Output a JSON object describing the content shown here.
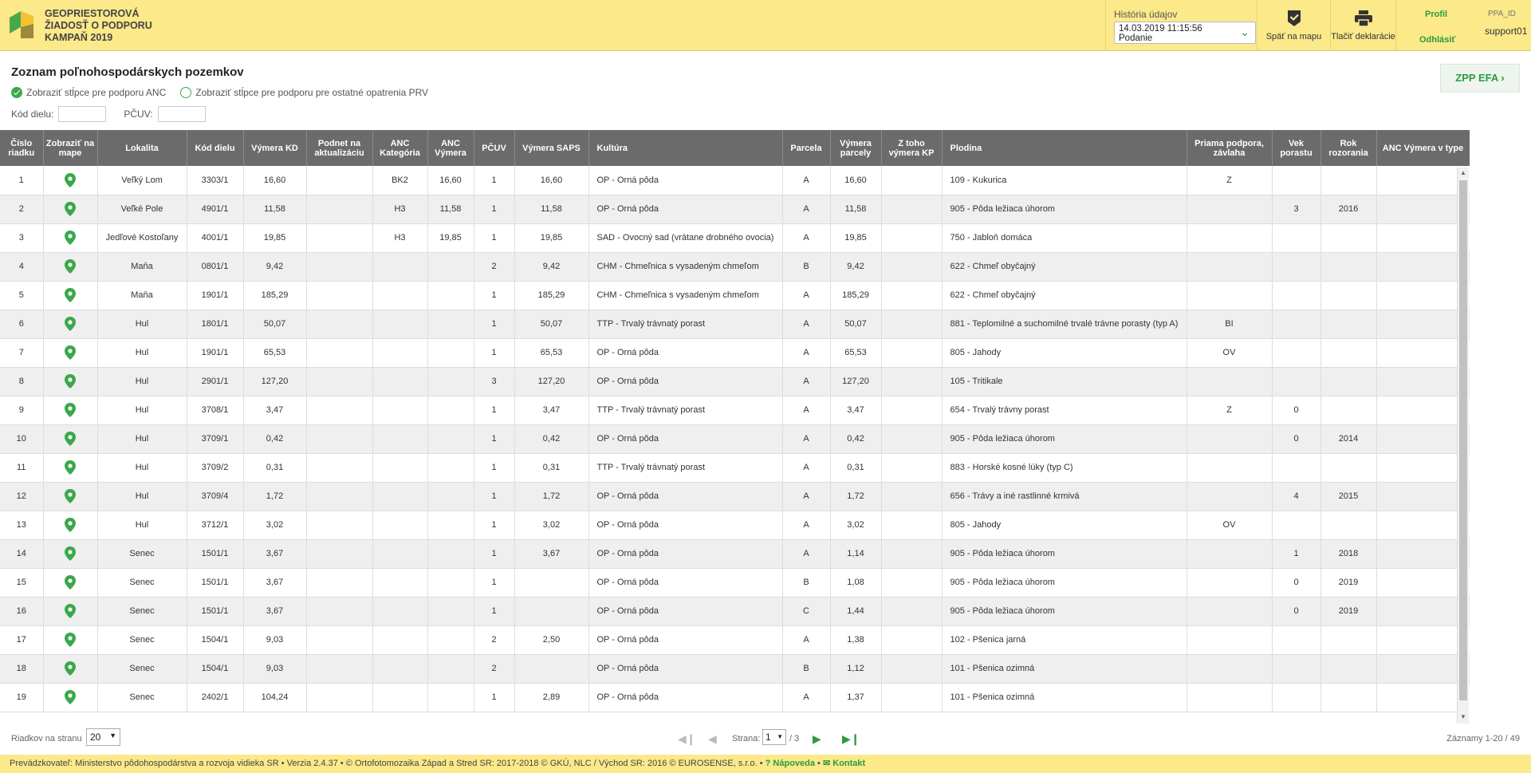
{
  "header": {
    "app_title_lines": [
      "GEOPRIESTOROVÁ",
      "ŽIADOSŤ O PODPORU",
      "KAMPAŇ 2019"
    ],
    "history_label": "História údajov",
    "history_value_line1": "14.03.2019 11:15:56",
    "history_value_line2": "Podanie",
    "back_to_map": "Späť na mapu",
    "print_declaration": "Tlačiť deklarácie",
    "profile": "Profil",
    "logout": "Odhlásiť",
    "user_label": "PPA_ID",
    "user_name": "support01"
  },
  "page": {
    "title": "Zoznam poľnohospodárskych pozemkov",
    "option_anc": "Zobraziť stĺpce pre podporu ANC",
    "option_prv": "Zobraziť stĺpce pre podporu pre ostatné opatrenia PRV",
    "filter_kod_dielu": "Kód dielu:",
    "filter_pcuv": "PČUV:",
    "zpp_efa_button": "ZPP EFA"
  },
  "table": {
    "headers": [
      "Číslo riadku",
      "Zobraziť na mape",
      "Lokalita",
      "Kód dielu",
      "Výmera KD",
      "Podnet na aktualizáciu",
      "ANC Kategória",
      "ANC Výmera",
      "PČUV",
      "Výmera SAPS",
      "Kultúra",
      "Parcela",
      "Výmera parcely",
      "Z toho výmera KP",
      "Plodina",
      "Priama podpora, závlaha",
      "Vek porastu",
      "Rok rozorania",
      "ANC Výmera v type"
    ],
    "rows": [
      [
        "1",
        "",
        "Veľký Lom",
        "3303/1",
        "16,60",
        "",
        "BK2",
        "16,60",
        "1",
        "16,60",
        "OP - Orná pôda",
        "A",
        "16,60",
        "",
        "109 - Kukurica",
        "Z",
        "",
        "",
        ""
      ],
      [
        "2",
        "",
        "Veľké Pole",
        "4901/1",
        "11,58",
        "",
        "H3",
        "11,58",
        "1",
        "11,58",
        "OP - Orná pôda",
        "A",
        "11,58",
        "",
        "905 - Pôda ležiaca úhorom",
        "",
        "3",
        "2016",
        ""
      ],
      [
        "3",
        "",
        "Jedľové Kostoľany",
        "4001/1",
        "19,85",
        "",
        "H3",
        "19,85",
        "1",
        "19,85",
        "SAD - Ovocný sad (vrátane drobného ovocia)",
        "A",
        "19,85",
        "",
        "750 - Jabloň domáca",
        "",
        "",
        "",
        ""
      ],
      [
        "4",
        "",
        "Maňa",
        "0801/1",
        "9,42",
        "",
        "",
        "",
        "2",
        "9,42",
        "CHM - Chmeľnica s vysadeným chmeľom",
        "B",
        "9,42",
        "",
        "622 - Chmeľ obyčajný",
        "",
        "",
        "",
        ""
      ],
      [
        "5",
        "",
        "Maňa",
        "1901/1",
        "185,29",
        "",
        "",
        "",
        "1",
        "185,29",
        "CHM - Chmeľnica s vysadeným chmeľom",
        "A",
        "185,29",
        "",
        "622 - Chmeľ obyčajný",
        "",
        "",
        "",
        ""
      ],
      [
        "6",
        "",
        "Hul",
        "1801/1",
        "50,07",
        "",
        "",
        "",
        "1",
        "50,07",
        "TTP - Trvalý trávnatý porast",
        "A",
        "50,07",
        "",
        "881 - Teplomilné a suchomilné trvalé trávne porasty (typ A)",
        "BI",
        "",
        "",
        ""
      ],
      [
        "7",
        "",
        "Hul",
        "1901/1",
        "65,53",
        "",
        "",
        "",
        "1",
        "65,53",
        "OP - Orná pôda",
        "A",
        "65,53",
        "",
        "805 - Jahody",
        "OV",
        "",
        "",
        ""
      ],
      [
        "8",
        "",
        "Hul",
        "2901/1",
        "127,20",
        "",
        "",
        "",
        "3",
        "127,20",
        "OP - Orná pôda",
        "A",
        "127,20",
        "",
        "105 - Tritikale",
        "",
        "",
        "",
        ""
      ],
      [
        "9",
        "",
        "Hul",
        "3708/1",
        "3,47",
        "",
        "",
        "",
        "1",
        "3,47",
        "TTP - Trvalý trávnatý porast",
        "A",
        "3,47",
        "",
        "654 - Trvalý trávny porast",
        "Z",
        "0",
        "",
        ""
      ],
      [
        "10",
        "",
        "Hul",
        "3709/1",
        "0,42",
        "",
        "",
        "",
        "1",
        "0,42",
        "OP - Orná pôda",
        "A",
        "0,42",
        "",
        "905 - Pôda ležiaca úhorom",
        "",
        "0",
        "2014",
        ""
      ],
      [
        "11",
        "",
        "Hul",
        "3709/2",
        "0,31",
        "",
        "",
        "",
        "1",
        "0,31",
        "TTP - Trvalý trávnatý porast",
        "A",
        "0,31",
        "",
        "883 - Horské kosné lúky (typ C)",
        "",
        "",
        "",
        ""
      ],
      [
        "12",
        "",
        "Hul",
        "3709/4",
        "1,72",
        "",
        "",
        "",
        "1",
        "1,72",
        "OP - Orná pôda",
        "A",
        "1,72",
        "",
        "656 - Trávy a iné rastlinné krmivá",
        "",
        "4",
        "2015",
        ""
      ],
      [
        "13",
        "",
        "Hul",
        "3712/1",
        "3,02",
        "",
        "",
        "",
        "1",
        "3,02",
        "OP - Orná pôda",
        "A",
        "3,02",
        "",
        "805 - Jahody",
        "OV",
        "",
        "",
        ""
      ],
      [
        "14",
        "",
        "Senec",
        "1501/1",
        "3,67",
        "",
        "",
        "",
        "1",
        "3,67",
        "OP - Orná pôda",
        "A",
        "1,14",
        "",
        "905 - Pôda ležiaca úhorom",
        "",
        "1",
        "2018",
        ""
      ],
      [
        "15",
        "",
        "Senec",
        "1501/1",
        "3,67",
        "",
        "",
        "",
        "1",
        "",
        "OP - Orná pôda",
        "B",
        "1,08",
        "",
        "905 - Pôda ležiaca úhorom",
        "",
        "0",
        "2019",
        ""
      ],
      [
        "16",
        "",
        "Senec",
        "1501/1",
        "3,67",
        "",
        "",
        "",
        "1",
        "",
        "OP - Orná pôda",
        "C",
        "1,44",
        "",
        "905 - Pôda ležiaca úhorom",
        "",
        "0",
        "2019",
        ""
      ],
      [
        "17",
        "",
        "Senec",
        "1504/1",
        "9,03",
        "",
        "",
        "",
        "2",
        "2,50",
        "OP - Orná pôda",
        "A",
        "1,38",
        "",
        "102 - Pšenica jarná",
        "",
        "",
        "",
        ""
      ],
      [
        "18",
        "",
        "Senec",
        "1504/1",
        "9,03",
        "",
        "",
        "",
        "2",
        "",
        "OP - Orná pôda",
        "B",
        "1,12",
        "",
        "101 - Pšenica ozimná",
        "",
        "",
        "",
        ""
      ],
      [
        "19",
        "",
        "Senec",
        "2402/1",
        "104,24",
        "",
        "",
        "",
        "1",
        "2,89",
        "OP - Orná pôda",
        "A",
        "1,37",
        "",
        "101 - Pšenica ozimná",
        "",
        "",
        "",
        ""
      ]
    ]
  },
  "pager": {
    "rows_per_page_label": "Riadkov na stranu",
    "rows_per_page_value": "20",
    "page_label": "Strana:",
    "page_value": "1",
    "page_total": "/ 3",
    "records": "Záznamy 1-20 / 49"
  },
  "footer": {
    "text": "Prevádzkovateľ: Ministerstvo pôdohospodárstva a rozvoja vidieka SR • Verzia 2.4.37 • © Ortofotomozaika Západ a Stred SR: 2017-2018 © GKÚ, NLC / Východ SR: 2016 © EUROSENSE, s.r.o. •",
    "help": "Nápoveda",
    "contact": "Kontakt"
  },
  "colors": {
    "header_bg": "#fbe98a",
    "accent_green": "#2a9b3e",
    "table_header_bg": "#6b6b6b"
  }
}
